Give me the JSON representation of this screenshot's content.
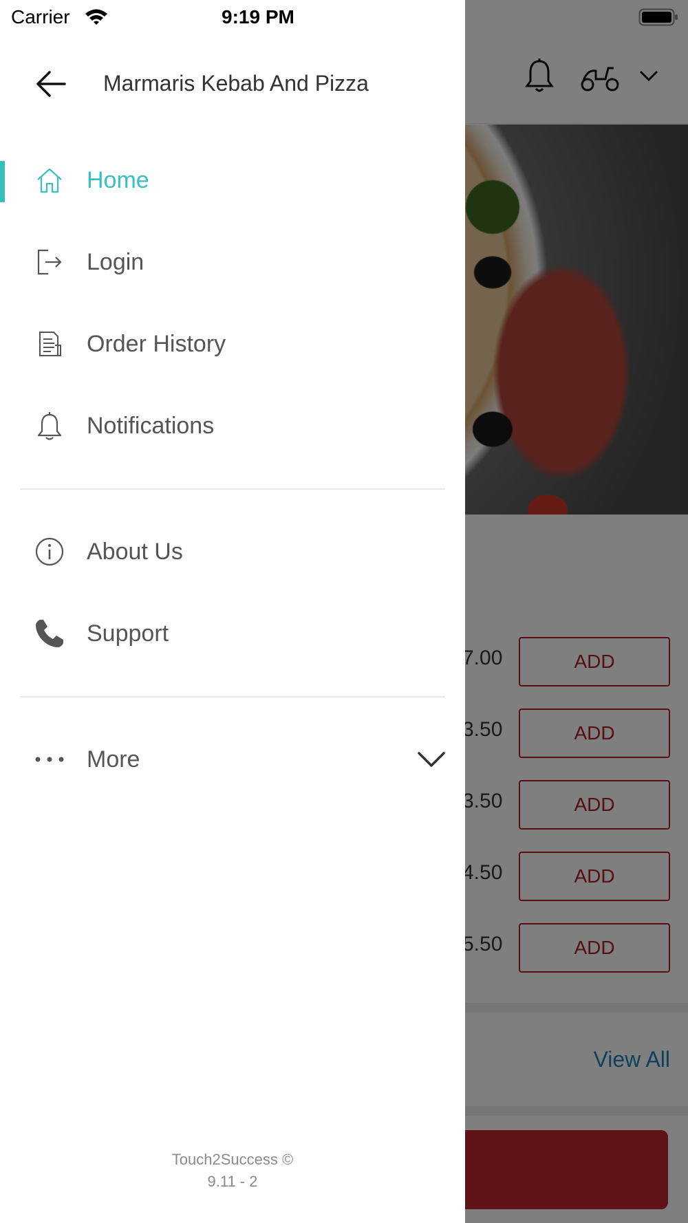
{
  "status_bar": {
    "carrier": "Carrier",
    "time": "9:19 PM"
  },
  "drawer": {
    "restaurant_name": "Marmaris Kebab And Pizza",
    "accent_color": "#37c0bf",
    "primary_items": [
      {
        "label": "Home",
        "icon": "home-icon",
        "active": true
      },
      {
        "label": "Login",
        "icon": "login-icon",
        "active": false
      },
      {
        "label": "Order History",
        "icon": "receipt-icon",
        "active": false
      },
      {
        "label": "Notifications",
        "icon": "bell-icon",
        "active": false
      }
    ],
    "secondary_items": [
      {
        "label": "About Us",
        "icon": "info-icon"
      },
      {
        "label": "Support",
        "icon": "phone-icon"
      }
    ],
    "more": {
      "label": "More",
      "icon": "more-dots-icon"
    },
    "footer": {
      "brand": "Touch2Success ©",
      "version": "9.11 - 2"
    }
  },
  "background": {
    "prices": [
      "7.00",
      "3.50",
      "3.50",
      "4.50",
      "5.50"
    ],
    "add_label": "ADD",
    "view_all": "View All",
    "brand_color": "#b01e24"
  }
}
